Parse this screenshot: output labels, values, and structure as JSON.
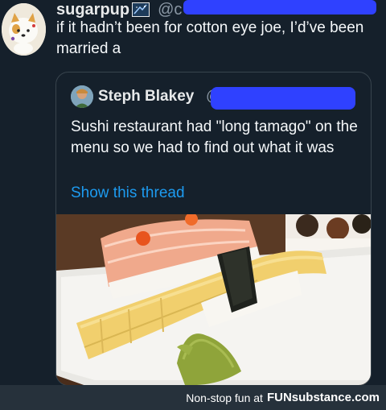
{
  "tweet": {
    "display_name": "sugarpup",
    "handle": "@c",
    "text": "if it hadn’t been for cotton eye joe, I’d’ve been married a",
    "avatar_icon": "dog-avatar-icon",
    "badge_icon": "emoji-badge-icon"
  },
  "quote": {
    "display_name": "Steph Blakey",
    "handle": "@",
    "avatar_icon": "person-avatar-icon",
    "text": "Sushi restaurant had \"long tamago\" on the menu so we had to find out what it was",
    "show_thread_label": "Show this thread",
    "image_alt": "long tamago sushi on a plate"
  },
  "footer": {
    "tagline": "Non-stop fun at",
    "site_bold": "FUN",
    "site_rest": "substance.com"
  },
  "colors": {
    "background": "#15202b",
    "link": "#1d9bf0",
    "redaction": "#2f41ff",
    "footer_bg": "#26313b"
  }
}
